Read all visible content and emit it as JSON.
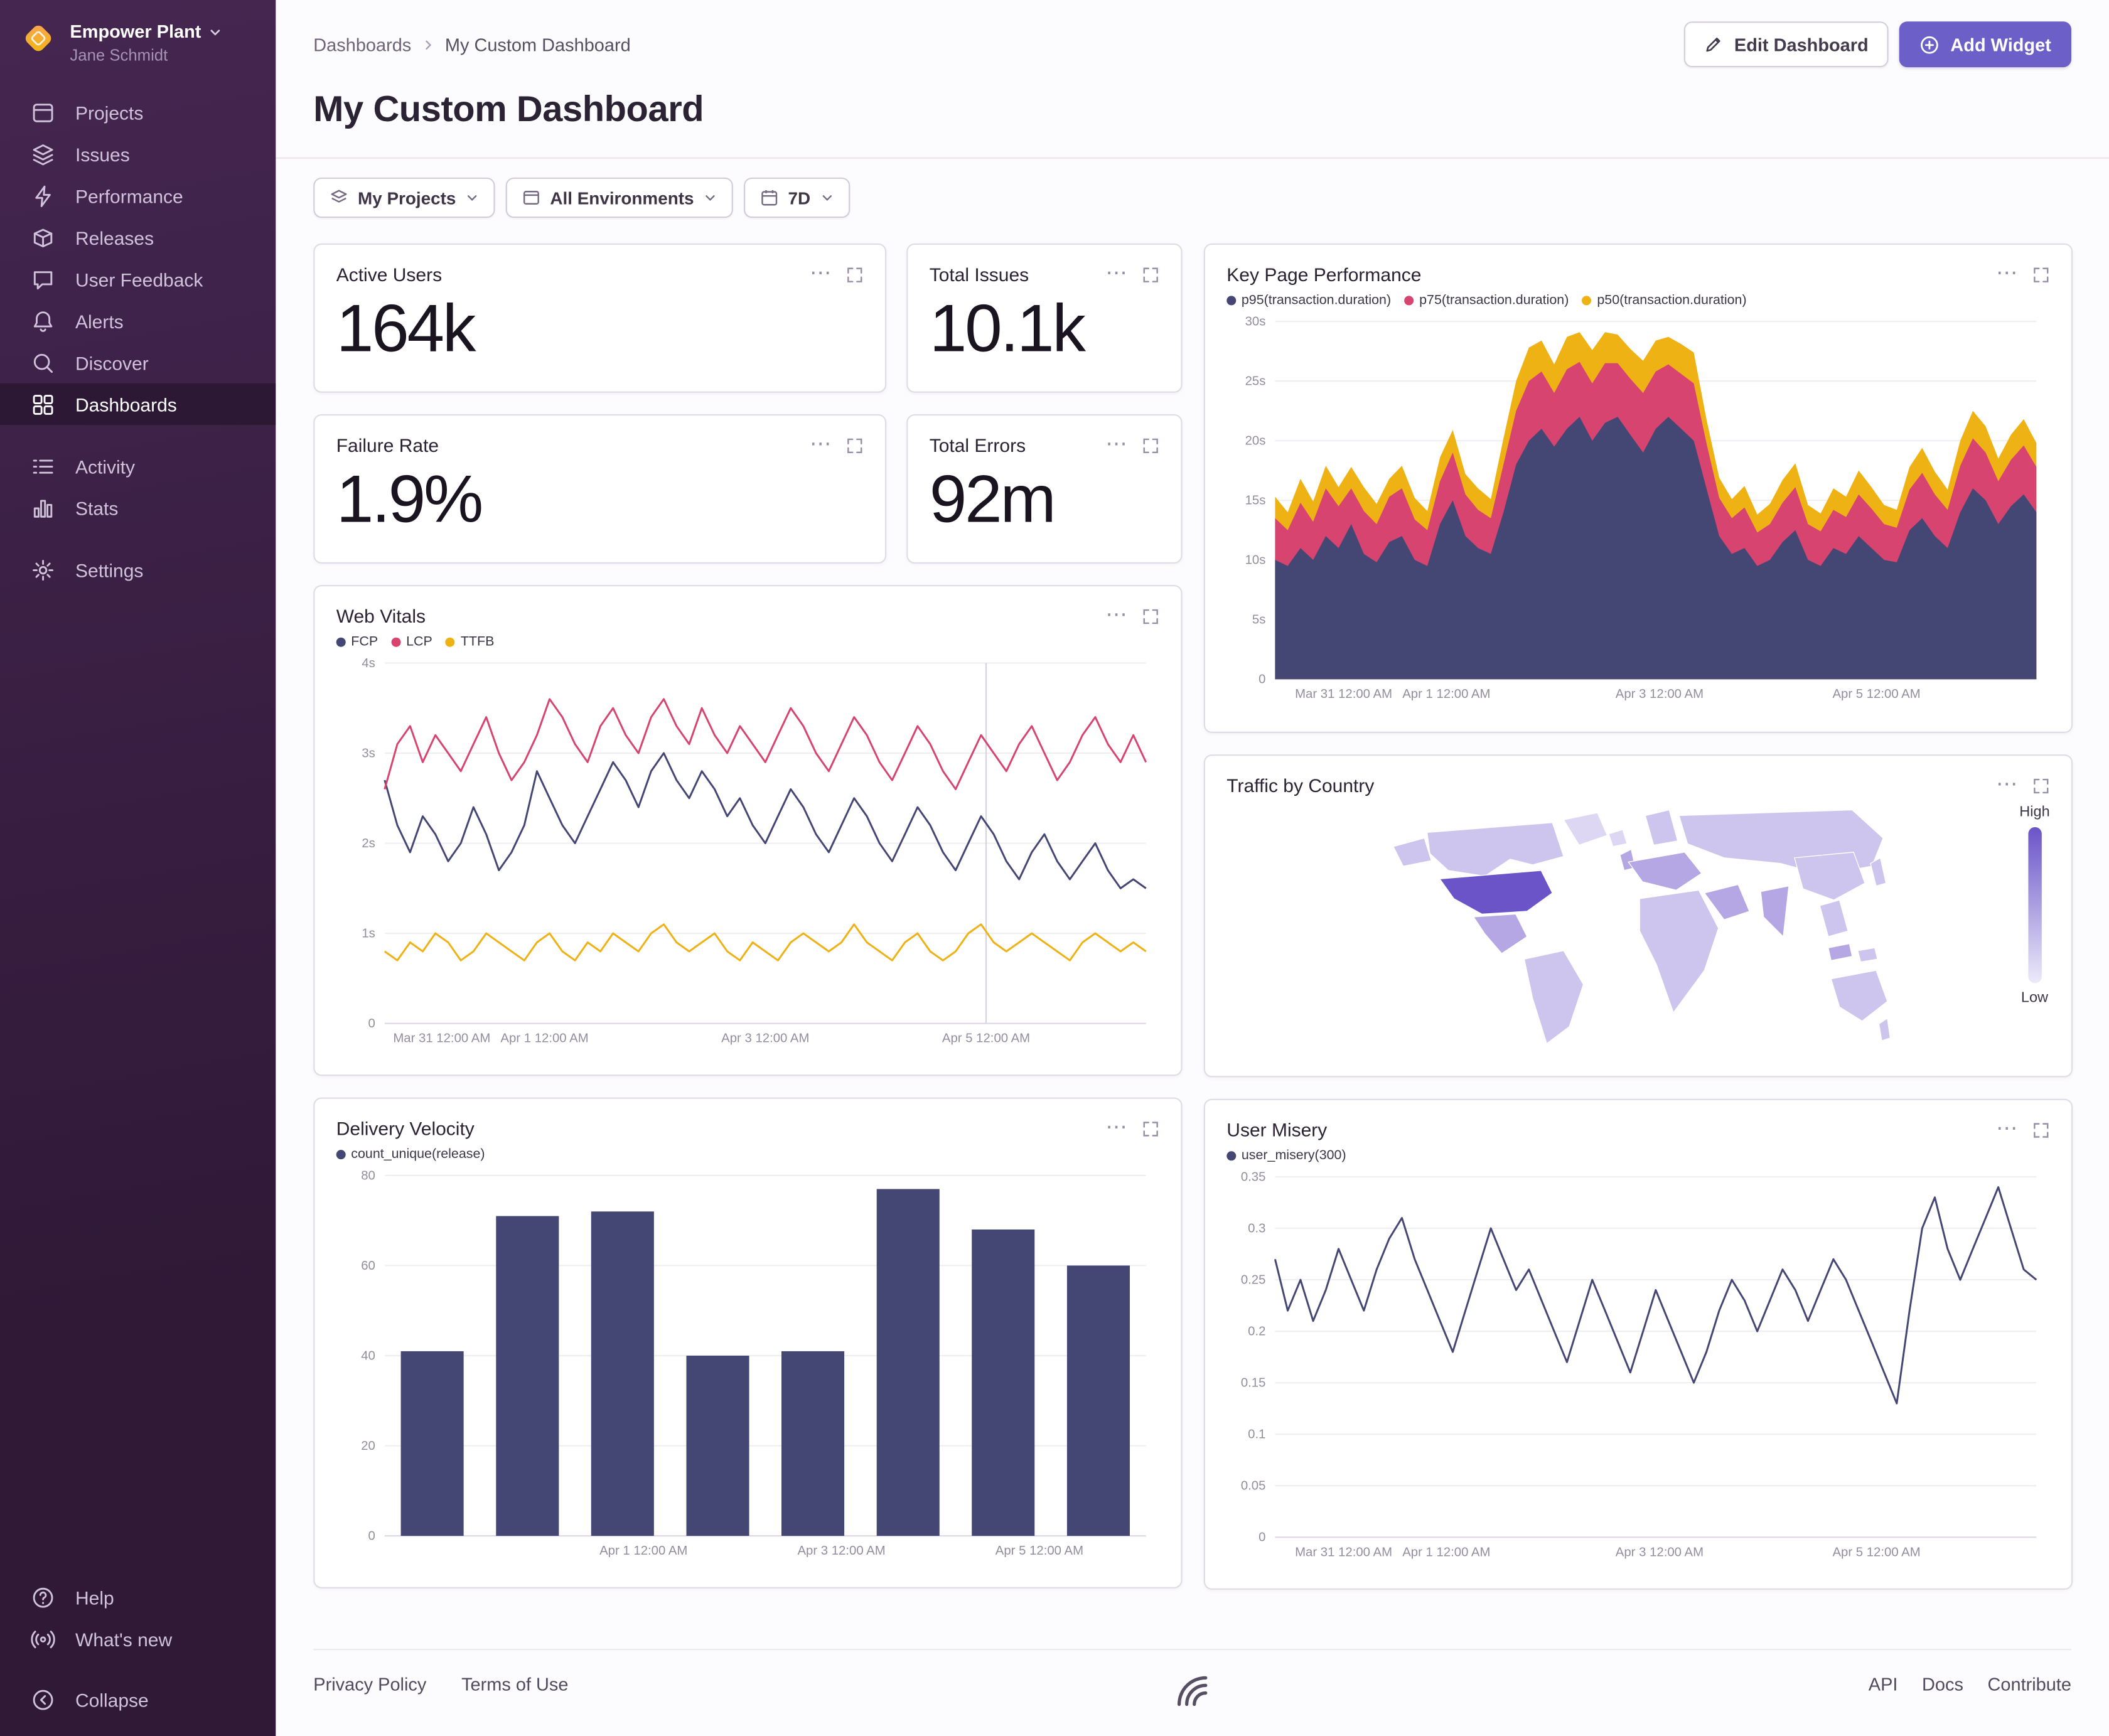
{
  "org": {
    "name": "Empower Plant",
    "user": "Jane Schmidt"
  },
  "sidebar": {
    "primary": [
      {
        "label": "Projects",
        "icon": "projects"
      },
      {
        "label": "Issues",
        "icon": "issues"
      },
      {
        "label": "Performance",
        "icon": "performance"
      },
      {
        "label": "Releases",
        "icon": "releases"
      },
      {
        "label": "User Feedback",
        "icon": "user-feedback"
      },
      {
        "label": "Alerts",
        "icon": "alerts"
      },
      {
        "label": "Discover",
        "icon": "discover"
      },
      {
        "label": "Dashboards",
        "icon": "dashboards",
        "active": true
      }
    ],
    "secondary": [
      {
        "label": "Activity",
        "icon": "activity"
      },
      {
        "label": "Stats",
        "icon": "stats"
      }
    ],
    "tertiary": [
      {
        "label": "Settings",
        "icon": "settings"
      }
    ],
    "bottom": [
      {
        "label": "Help",
        "icon": "help"
      },
      {
        "label": "What's new",
        "icon": "whats-new"
      }
    ],
    "collapse": [
      {
        "label": "Collapse",
        "icon": "collapse"
      }
    ]
  },
  "breadcrumb": {
    "root": "Dashboards",
    "current": "My Custom Dashboard"
  },
  "header": {
    "title": "My Custom Dashboard",
    "edit_button": "Edit Dashboard",
    "add_button": "Add Widget"
  },
  "filters": {
    "projects": "My Projects",
    "environments": "All Environments",
    "period": "7D"
  },
  "icons": {
    "ellipsis": "⋯"
  },
  "stats": [
    {
      "title": "Active Users",
      "value": "164k"
    },
    {
      "title": "Total Issues",
      "value": "10.1k"
    },
    {
      "title": "Failure Rate",
      "value": "1.9%"
    },
    {
      "title": "Total Errors",
      "value": "92m"
    }
  ],
  "charts": {
    "key_page_performance": {
      "type": "stacked_area",
      "title": "Key Page Performance",
      "ylim": [
        0,
        30
      ],
      "yticks": [
        [
          0,
          "0"
        ],
        [
          5,
          "5s"
        ],
        [
          10,
          "10s"
        ],
        [
          15,
          "15s"
        ],
        [
          20,
          "20s"
        ],
        [
          25,
          "25s"
        ],
        [
          30,
          "30s"
        ]
      ],
      "xticks": [
        [
          0.09,
          "Mar 31 12:00 AM"
        ],
        [
          0.225,
          "Apr 1 12:00 AM"
        ],
        [
          0.505,
          "Apr 3 12:00 AM"
        ],
        [
          0.79,
          "Apr 5 12:00 AM"
        ]
      ],
      "legend": [
        {
          "label": "p95(transaction.duration)",
          "color": "#444674"
        },
        {
          "label": "p75(transaction.duration)",
          "color": "#d6446f"
        },
        {
          "label": "p50(transaction.duration)",
          "color": "#efb215"
        }
      ],
      "series": [
        {
          "name": "p95(transaction.duration)",
          "color": "#444674",
          "values": [
            10,
            9.5,
            11,
            10,
            12,
            11,
            13,
            10.5,
            9.8,
            11.5,
            12,
            10,
            9.5,
            13,
            15,
            12,
            11,
            10.5,
            14,
            18,
            20,
            21,
            19.5,
            21,
            22,
            20,
            21.5,
            22,
            20.5,
            19,
            21,
            22,
            21,
            20,
            16,
            12,
            10.5,
            11,
            9.5,
            10,
            11.5,
            12.5,
            10,
            9.5,
            11,
            10.5,
            12,
            11,
            10,
            9.8,
            12.5,
            13.5,
            12,
            11,
            14,
            16,
            15,
            13,
            14.5,
            15.5,
            14
          ]
        },
        {
          "name": "p75(transaction.duration)",
          "color": "#d6446f",
          "values": [
            3.5,
            3,
            3.8,
            3.2,
            4,
            3.5,
            3,
            3.6,
            3.2,
            3.8,
            4,
            3.4,
            3,
            3.6,
            4,
            3.5,
            3.2,
            3,
            4,
            4.5,
            5,
            4.8,
            4.5,
            5,
            4.6,
            4.8,
            5,
            4.5,
            4.7,
            5,
            4.8,
            4.4,
            4.6,
            4.8,
            3.8,
            3.2,
            3,
            3.4,
            2.8,
            3,
            3.3,
            3.6,
            3,
            2.9,
            3.2,
            3.1,
            3.5,
            3.3,
            3,
            2.9,
            3.4,
            3.8,
            3.5,
            3.2,
            3.9,
            4.2,
            4,
            3.6,
            3.9,
            4.1,
            3.8
          ]
        },
        {
          "name": "p50(transaction.duration)",
          "color": "#efb215",
          "values": [
            1.8,
            1.5,
            2,
            1.7,
            1.9,
            1.6,
            1.8,
            2,
            1.7,
            1.5,
            1.9,
            1.8,
            1.6,
            2,
            1.9,
            1.7,
            1.8,
            1.6,
            2.2,
            2.5,
            2.8,
            2.6,
            2.4,
            2.7,
            2.5,
            2.8,
            2.6,
            2.4,
            2.5,
            2.7,
            2.6,
            2.3,
            2.5,
            2.6,
            2,
            1.7,
            1.6,
            1.8,
            1.5,
            1.7,
            1.9,
            2,
            1.6,
            1.5,
            1.8,
            1.7,
            2,
            1.8,
            1.6,
            1.5,
            1.9,
            2.1,
            1.9,
            1.7,
            2.1,
            2.3,
            2.2,
            1.9,
            2.1,
            2.2,
            2
          ]
        }
      ]
    },
    "web_vitals": {
      "type": "line",
      "title": "Web Vitals",
      "ylim": [
        0,
        4
      ],
      "vline": 0.79,
      "yticks": [
        [
          0,
          "0"
        ],
        [
          1,
          "1s"
        ],
        [
          2,
          "2s"
        ],
        [
          3,
          "3s"
        ],
        [
          4,
          "4s"
        ]
      ],
      "xticks": [
        [
          0.075,
          "Mar 31 12:00 AM"
        ],
        [
          0.21,
          "Apr 1 12:00 AM"
        ],
        [
          0.5,
          "Apr 3 12:00 AM"
        ],
        [
          0.79,
          "Apr 5 12:00 AM"
        ]
      ],
      "legend": [
        {
          "label": "FCP",
          "color": "#444674"
        },
        {
          "label": "LCP",
          "color": "#d6446f"
        },
        {
          "label": "TTFB",
          "color": "#efb215"
        }
      ],
      "series": [
        {
          "name": "FCP",
          "color": "#444674",
          "values": [
            2.7,
            2.2,
            1.9,
            2.3,
            2.1,
            1.8,
            2,
            2.4,
            2.1,
            1.7,
            1.9,
            2.2,
            2.8,
            2.5,
            2.2,
            2,
            2.3,
            2.6,
            2.9,
            2.7,
            2.4,
            2.8,
            3,
            2.7,
            2.5,
            2.8,
            2.6,
            2.3,
            2.5,
            2.2,
            2,
            2.3,
            2.6,
            2.4,
            2.1,
            1.9,
            2.2,
            2.5,
            2.3,
            2,
            1.8,
            2.1,
            2.4,
            2.2,
            1.9,
            1.7,
            2,
            2.3,
            2.1,
            1.8,
            1.6,
            1.9,
            2.1,
            1.8,
            1.6,
            1.8,
            2,
            1.7,
            1.5,
            1.6,
            1.5
          ]
        },
        {
          "name": "LCP",
          "color": "#d6446f",
          "values": [
            2.6,
            3.1,
            3.3,
            2.9,
            3.2,
            3,
            2.8,
            3.1,
            3.4,
            3,
            2.7,
            2.9,
            3.2,
            3.6,
            3.4,
            3.1,
            2.9,
            3.3,
            3.5,
            3.2,
            3,
            3.4,
            3.6,
            3.3,
            3.1,
            3.5,
            3.2,
            3,
            3.3,
            3.1,
            2.9,
            3.2,
            3.5,
            3.3,
            3,
            2.8,
            3.1,
            3.4,
            3.2,
            2.9,
            2.7,
            3,
            3.3,
            3.1,
            2.8,
            2.6,
            2.9,
            3.2,
            3,
            2.8,
            3.1,
            3.3,
            3,
            2.7,
            2.9,
            3.2,
            3.4,
            3.1,
            2.9,
            3.2,
            2.9
          ]
        },
        {
          "name": "TTFB",
          "color": "#efb215",
          "values": [
            0.8,
            0.7,
            0.9,
            0.8,
            1,
            0.9,
            0.7,
            0.8,
            1,
            0.9,
            0.8,
            0.7,
            0.9,
            1,
            0.8,
            0.7,
            0.9,
            0.8,
            1,
            0.9,
            0.8,
            1,
            1.1,
            0.9,
            0.8,
            0.9,
            1,
            0.8,
            0.7,
            0.9,
            0.8,
            0.7,
            0.9,
            1,
            0.9,
            0.8,
            0.9,
            1.1,
            0.9,
            0.8,
            0.7,
            0.9,
            1,
            0.8,
            0.7,
            0.8,
            1,
            1.1,
            0.9,
            0.8,
            0.9,
            1,
            0.9,
            0.8,
            0.7,
            0.9,
            1,
            0.9,
            0.8,
            0.9,
            0.8
          ]
        }
      ]
    },
    "delivery_velocity": {
      "type": "bar",
      "title": "Delivery Velocity",
      "color": "#444674",
      "ylim": [
        0,
        80
      ],
      "yticks": [
        [
          0,
          "0"
        ],
        [
          20,
          "20"
        ],
        [
          40,
          "40"
        ],
        [
          60,
          "60"
        ],
        [
          80,
          "80"
        ]
      ],
      "xticks": [
        [
          0.34,
          "Apr 1 12:00 AM"
        ],
        [
          0.6,
          "Apr 3 12:00 AM"
        ],
        [
          0.86,
          "Apr 5 12:00 AM"
        ]
      ],
      "legend": [
        {
          "label": "count_unique(release)",
          "color": "#444674"
        }
      ],
      "values": [
        41,
        71,
        72,
        40,
        41,
        77,
        68,
        60
      ]
    },
    "user_misery": {
      "type": "line",
      "title": "User Misery",
      "ylim": [
        0,
        0.35
      ],
      "yticks": [
        [
          0,
          "0"
        ],
        [
          0.05,
          "0.05"
        ],
        [
          0.1,
          "0.1"
        ],
        [
          0.15,
          "0.15"
        ],
        [
          0.2,
          "0.2"
        ],
        [
          0.25,
          "0.25"
        ],
        [
          0.3,
          "0.3"
        ],
        [
          0.35,
          "0.35"
        ]
      ],
      "xticks": [
        [
          0.09,
          "Mar 31 12:00 AM"
        ],
        [
          0.225,
          "Apr 1 12:00 AM"
        ],
        [
          0.505,
          "Apr 3 12:00 AM"
        ],
        [
          0.79,
          "Apr 5 12:00 AM"
        ]
      ],
      "legend": [
        {
          "label": "user_misery(300)",
          "color": "#444674"
        }
      ],
      "series": [
        {
          "name": "user_misery(300)",
          "color": "#444674",
          "values": [
            0.27,
            0.22,
            0.25,
            0.21,
            0.24,
            0.28,
            0.25,
            0.22,
            0.26,
            0.29,
            0.31,
            0.27,
            0.24,
            0.21,
            0.18,
            0.22,
            0.26,
            0.3,
            0.27,
            0.24,
            0.26,
            0.23,
            0.2,
            0.17,
            0.21,
            0.25,
            0.22,
            0.19,
            0.16,
            0.2,
            0.24,
            0.21,
            0.18,
            0.15,
            0.18,
            0.22,
            0.25,
            0.23,
            0.2,
            0.23,
            0.26,
            0.24,
            0.21,
            0.24,
            0.27,
            0.25,
            0.22,
            0.19,
            0.16,
            0.13,
            0.22,
            0.3,
            0.33,
            0.28,
            0.25,
            0.28,
            0.31,
            0.34,
            0.3,
            0.26,
            0.25
          ]
        }
      ]
    }
  },
  "map_widget": {
    "title": "Traffic by Country",
    "legend_high": "High",
    "legend_low": "Low"
  },
  "page_footer": {
    "left": [
      "Privacy Policy",
      "Terms of Use"
    ],
    "right": [
      "API",
      "Docs",
      "Contribute"
    ]
  },
  "colors": {
    "accent": "#6c5fc7",
    "sidebar_top": "#452650",
    "sidebar_bottom": "#2f1937",
    "chart_navy": "#444674",
    "chart_pink": "#d6446f",
    "chart_yellow": "#efb215",
    "map_high": "#6a54c8",
    "map_mid": "#b4a7e4",
    "map_low": "#cdc5ee",
    "map_pale": "#ddd7f4"
  }
}
